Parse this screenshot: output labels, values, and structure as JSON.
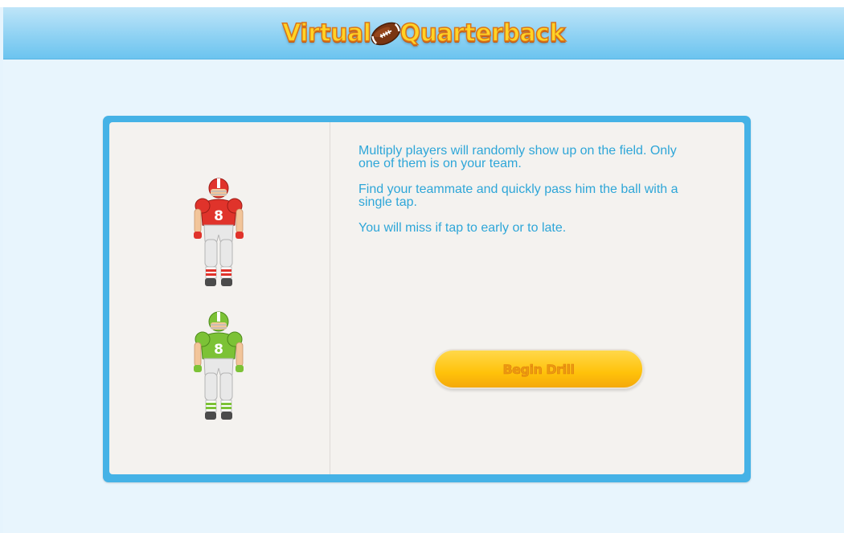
{
  "header": {
    "title_left": "Virtual",
    "title_right": "Quarterback",
    "logo_icon": "football-icon"
  },
  "colors": {
    "header_blue": "#8fd2f3",
    "frame_blue": "#45b2e6",
    "text_blue": "#2ea6d8",
    "button_yellow": "#ffc20a",
    "red_team": "#e0332b",
    "green_team": "#7cc236"
  },
  "players": [
    {
      "icon": "red-player-icon",
      "jersey_number": "8"
    },
    {
      "icon": "green-player-icon",
      "jersey_number": "8"
    }
  ],
  "instructions": [
    "Multiply players will randomly show up on the field. Only one of them is on your team.",
    "Find your teammate and quickly pass him the ball with a single tap.",
    "You will miss if tap to early or to late."
  ],
  "button": {
    "label": "Begin Drill"
  }
}
